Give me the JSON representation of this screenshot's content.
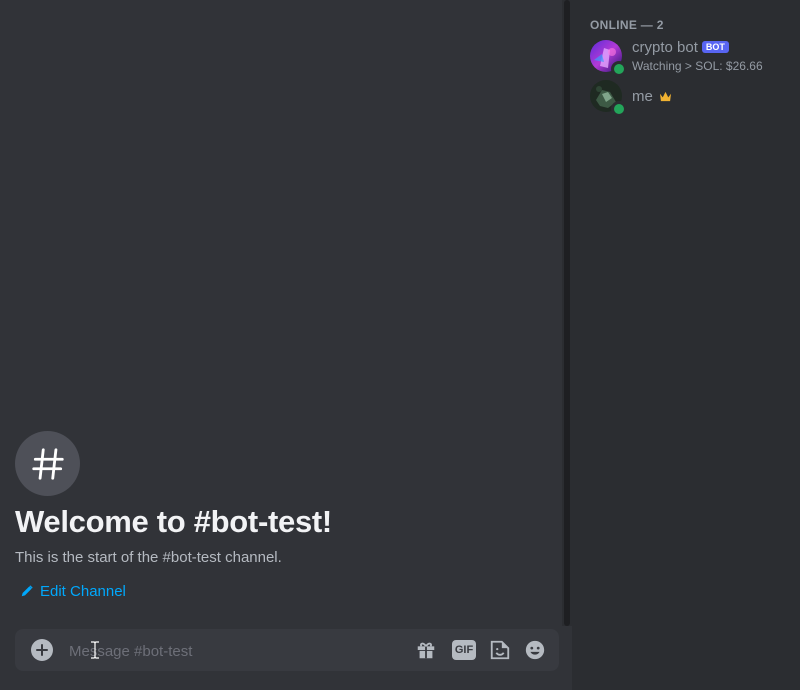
{
  "channel": {
    "welcome_title": "Welcome to #bot-test!",
    "welcome_subtitle": "This is the start of the #bot-test channel.",
    "edit_label": "Edit Channel"
  },
  "composer": {
    "placeholder": "Message #bot-test",
    "value": "",
    "gif_label": "GIF",
    "icons": [
      "plus-circle-icon",
      "gift-icon",
      "gif-icon",
      "sticker-icon",
      "emoji-icon"
    ]
  },
  "members": {
    "header": "ONLINE — 2",
    "list": [
      {
        "name": "crypto bot",
        "tag": "BOT",
        "status_text": "Watching > SOL: $26.66",
        "status": "online"
      },
      {
        "name": "me",
        "badge": "crown-icon",
        "status": "online"
      }
    ]
  },
  "colors": {
    "background": "#313338",
    "sidebar": "#2b2d31",
    "link": "#00a8fc",
    "online": "#23a55a",
    "bot_tag": "#5865f2",
    "crown": "#f0b232"
  }
}
